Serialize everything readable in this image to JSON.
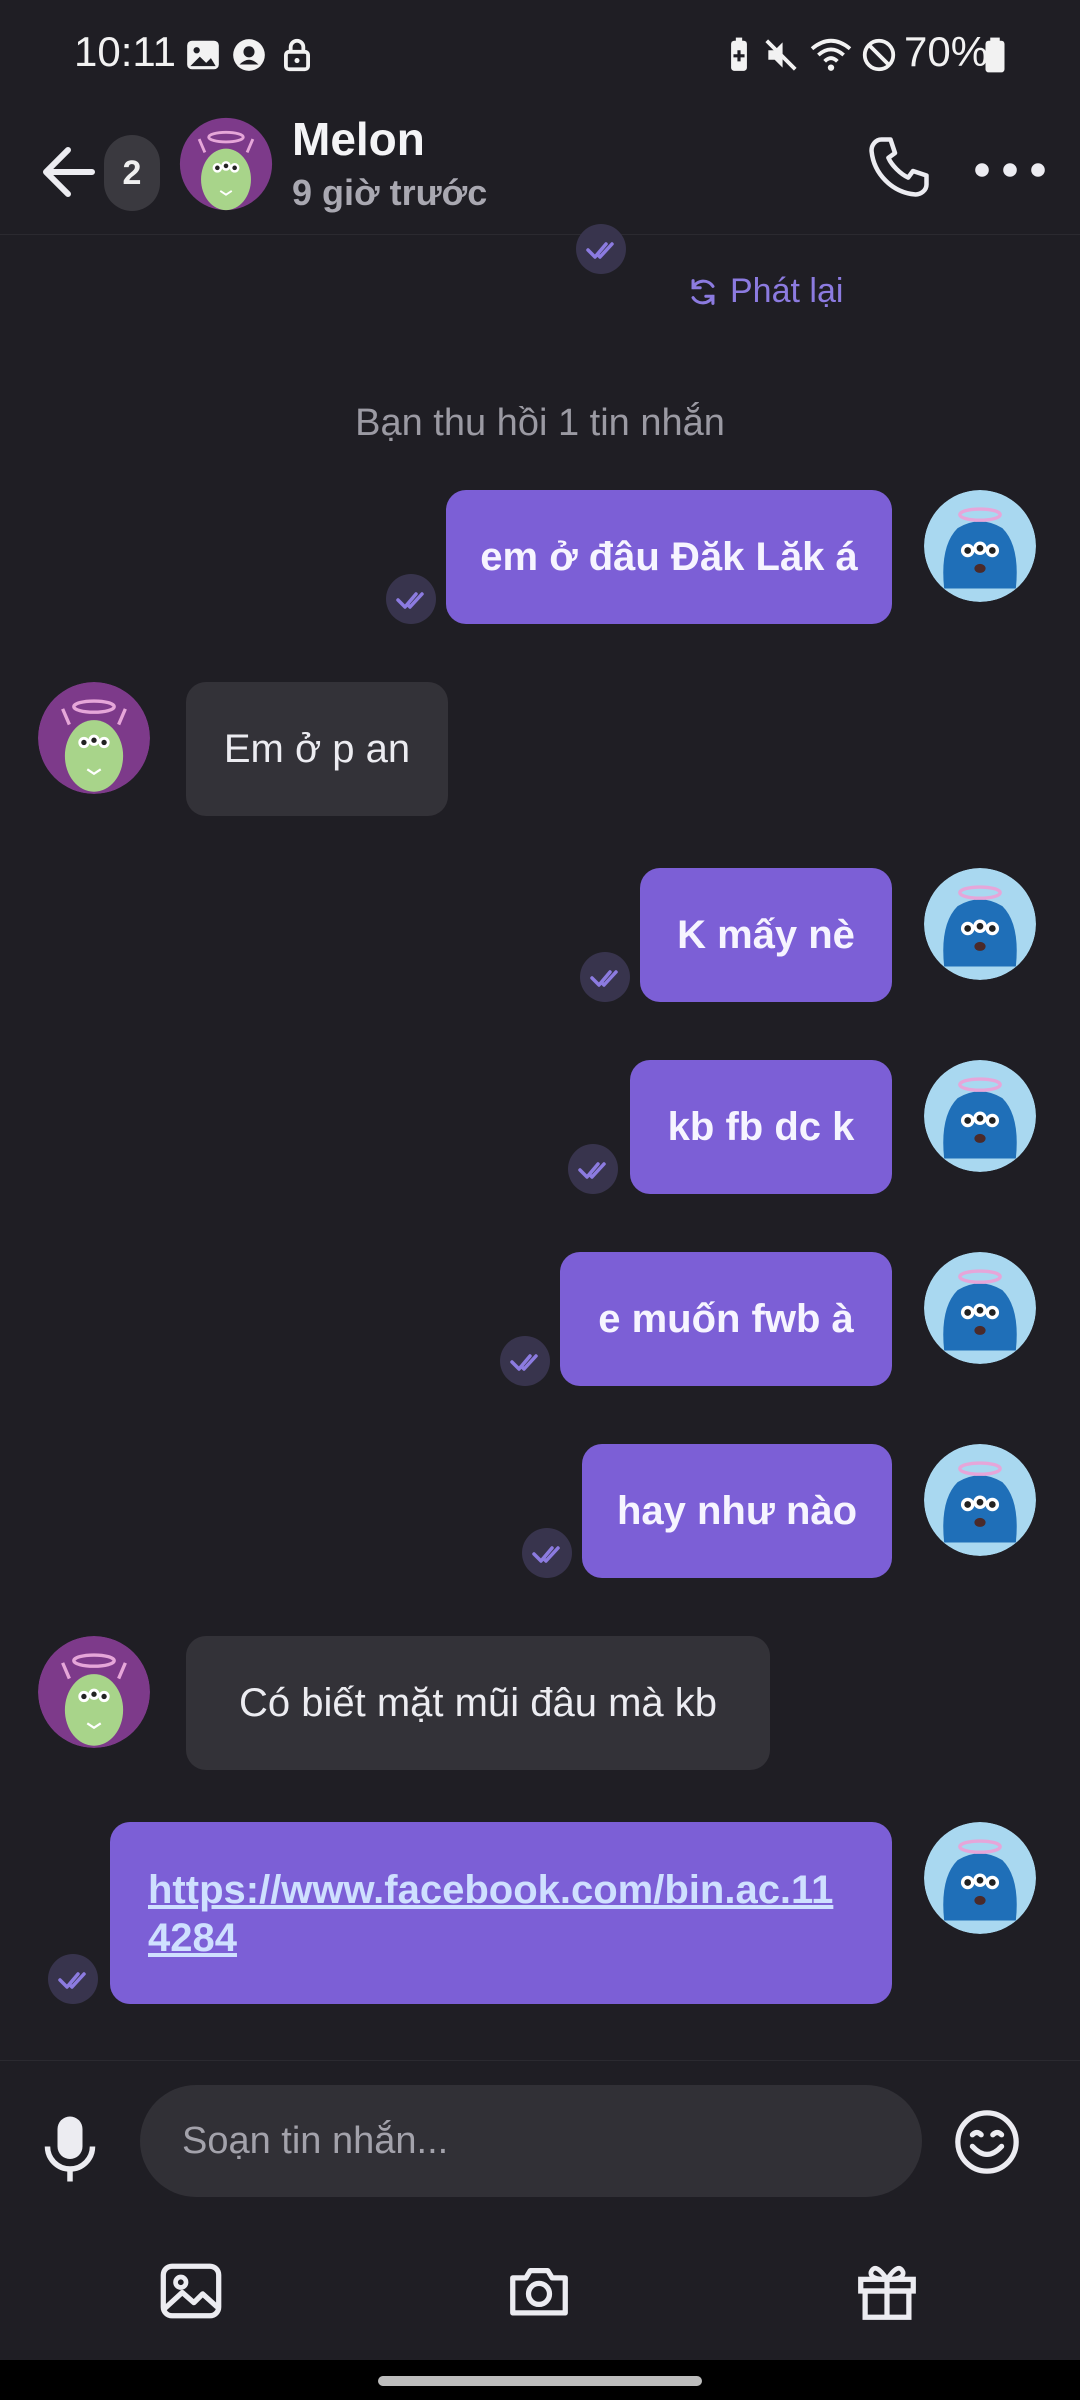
{
  "status_bar": {
    "time": "10:11",
    "battery_percent": "70%",
    "icons": [
      "gallery-icon",
      "account-icon",
      "lock-icon",
      "battery-saver-icon",
      "mute-icon",
      "wifi-icon",
      "do-not-disturb-icon",
      "battery-icon"
    ]
  },
  "header": {
    "back_icon": "arrow-left-icon",
    "unread_count": "2",
    "contact_name": "Melon",
    "contact_status": "9 giờ trước",
    "call_icon": "phone-icon",
    "more_icon": "more-dots-icon"
  },
  "chat": {
    "replay_label": "Phát lại",
    "recall_note": "Bạn thu hồi 1 tin nhắn",
    "messages": [
      {
        "from": "me",
        "text": "em ở đâu Đăk Lăk á",
        "status": "seen"
      },
      {
        "from": "contact",
        "text": "Em ở p an"
      },
      {
        "from": "me",
        "text": "K mấy nè",
        "status": "seen"
      },
      {
        "from": "me",
        "text": "kb fb dc k",
        "status": "seen"
      },
      {
        "from": "me",
        "text": "e muốn fwb à",
        "status": "seen"
      },
      {
        "from": "me",
        "text": "hay như nào",
        "status": "seen"
      },
      {
        "from": "contact",
        "text": "Có biết mặt mũi đâu mà kb"
      },
      {
        "from": "me",
        "text": "https://www.facebook.com/bin.ac.114284",
        "status": "seen",
        "is_link": true
      }
    ]
  },
  "composer": {
    "placeholder": "Soạn tin nhắn...",
    "mic_icon": "microphone-icon",
    "emoji_icon": "emoji-icon"
  },
  "toolbar": {
    "items": [
      "image-icon",
      "camera-icon",
      "gift-icon"
    ]
  },
  "colors": {
    "background": "#1f1e24",
    "outgoing_bubble": "#7c5fd6",
    "incoming_bubble": "#333238",
    "accent": "#8c7be0",
    "link": "#cfe0ff"
  }
}
